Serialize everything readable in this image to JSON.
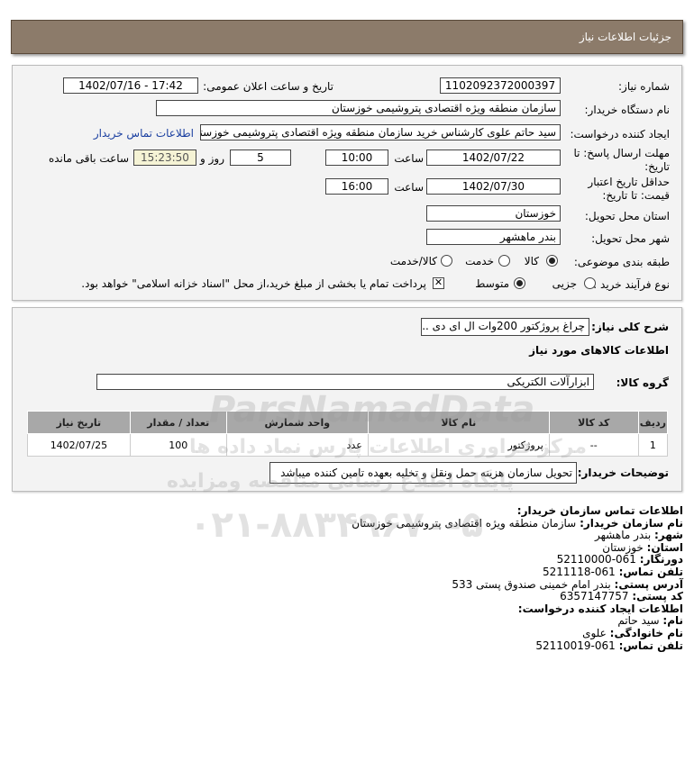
{
  "header": {
    "title": "جزئیات اطلاعات نیاز"
  },
  "form": {
    "need_number_label": "شماره نیاز:",
    "need_number": "1102092372000397",
    "announce_label": "تاریخ و ساعت اعلان عمومی:",
    "announce_value": "1402/07/16 - 17:42",
    "buyer_org_label": "نام دستگاه خریدار:",
    "buyer_org": "سازمان منطقه ویژه اقتصادی پتروشیمی خوزستان",
    "creator_label": "ایجاد کننده درخواست:",
    "creator": "سید حاتم علوی کارشناس خرید سازمان منطقه ویژه اقتصادی پتروشیمی خوزستان",
    "contact_link": "اطلاعات تماس خریدار",
    "deadline_label_1": "مهلت ارسال پاسخ: تا",
    "deadline_label_2": "تاریخ:",
    "deadline_date": "1402/07/22",
    "hour_label": "ساعت",
    "deadline_time": "10:00",
    "days_value": "5",
    "days_label": "روز و",
    "remaining_time": "15:23:50",
    "remaining_label": "ساعت باقی مانده",
    "validity_label_1": "حداقل تاریخ اعتبار",
    "validity_label_2": "قیمت: تا تاریخ:",
    "validity_date": "1402/07/30",
    "validity_time": "16:00",
    "province_label": "استان محل تحویل:",
    "province": "خوزستان",
    "city_label": "شهر محل تحویل:",
    "city": "بندر ماهشهر",
    "category_label": "طبقه بندی موضوعی:",
    "category_options": [
      "کالا",
      "خدمت",
      "کالا/خدمت"
    ],
    "process_label": "نوع فرآیند خرید :",
    "process_options": [
      "جزیی",
      "متوسط"
    ],
    "payment_note": "پرداخت تمام یا بخشی از مبلغ خرید،از محل \"اسناد خزانه اسلامی\" خواهد بود."
  },
  "details": {
    "summary_label": "شرح کلی نیاز:",
    "summary": "چراغ پروژکتور 200وات ال ای دی ...",
    "goods_info_title": "اطلاعات کالاهای مورد نیاز",
    "group_label": "گروه کالا:",
    "group": "ابزارآلات الکتریکی",
    "table": {
      "headers": [
        "ردیف",
        "کد کالا",
        "نام کالا",
        "واحد شمارش",
        "تعداد / مقدار",
        "تاریخ نیاز"
      ],
      "rows": [
        [
          "1",
          "--",
          "پروژکتور",
          "عدد",
          "100",
          "1402/07/25"
        ]
      ]
    },
    "buyer_notes_label": "توضیحات خریدار:",
    "buyer_notes": "تحویل سازمان هزینه حمل ونقل و تخلیه بعهده تامین کننده میباشد"
  },
  "contact": {
    "title": "اطلاعات تماس سازمان خریدار:",
    "org_label": "نام سازمان خریدار:",
    "org": "سازمان منطقه ویژه اقتصادی پتروشیمی خوزستان",
    "city_label": "شهر:",
    "city": "بندر ماهشهر",
    "province_label": "استان:",
    "province": "خوزستان",
    "fax_label": "دورنگار:",
    "fax": "061-52110000",
    "phone_label": "تلفن تماس:",
    "phone": "061-5211118",
    "address_label": "آدرس پستی:",
    "address": "بندر امام خمینی صندوق پستی 533",
    "postal_label": "کد پستی:",
    "postal": "6357147757",
    "creator_title": "اطلاعات ایجاد کننده درخواست:",
    "name_label": "نام:",
    "name": "سید حاتم",
    "family_label": "نام خانوادگی:",
    "family": "علوی",
    "creator_phone_label": "تلفن تماس:",
    "creator_phone": "061-52110019"
  },
  "watermark": {
    "brand": "ParsNamadData",
    "line1": "مرکز فراوری اطلاعات پارس نماد داده ها",
    "line2": "پایگاه اطلاع رسانی مناقصه ومزایده",
    "phone": "۰۲۱-۸۸۳۴۹۶۷۰-۵"
  }
}
